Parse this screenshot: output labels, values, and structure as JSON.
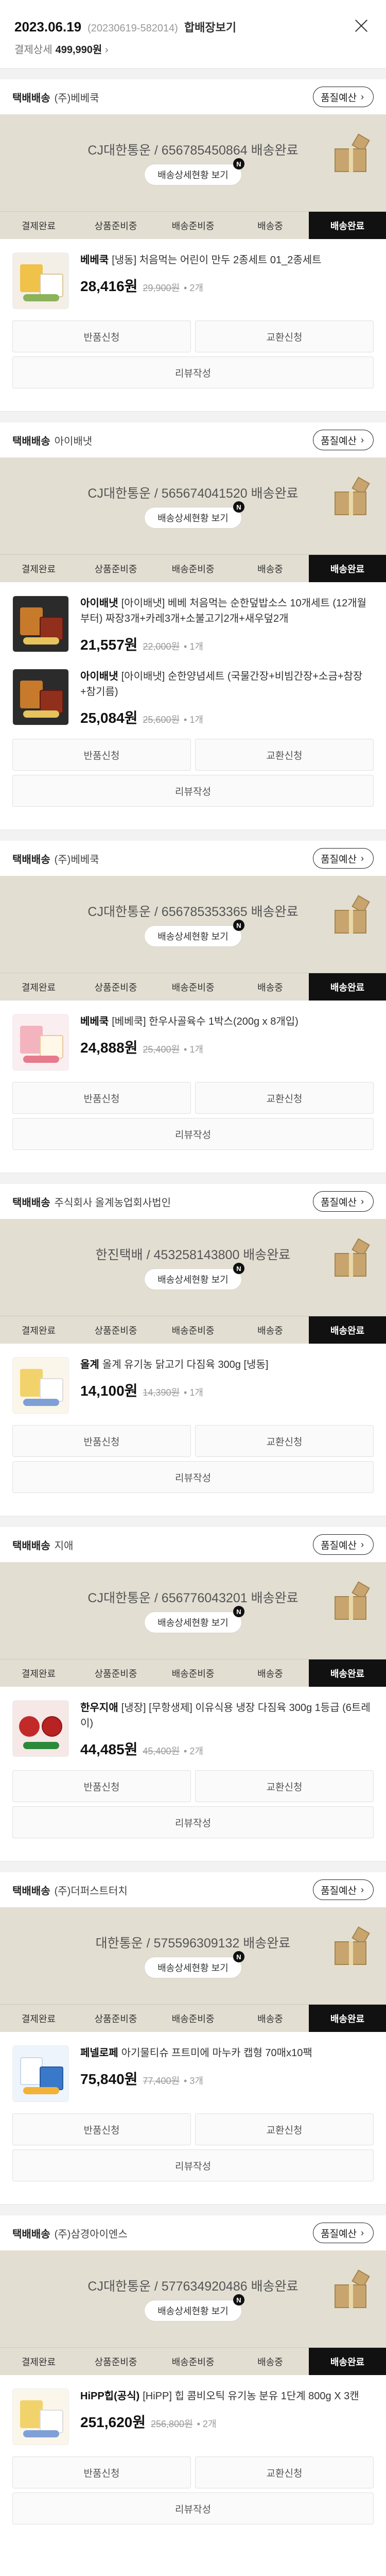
{
  "order": {
    "date": "2023.06.19",
    "number": "(20230619-582014)",
    "merge_label": "합배장보기",
    "pay_label": "결제상세",
    "pay_amount": "499,990원",
    "pay_arrow": "›"
  },
  "common": {
    "quality_label": "품질예산",
    "quality_arrow": "›",
    "tracking_detail_label": "배송상세현황 보기",
    "badge": "N",
    "steps": [
      "결제완료",
      "상품준비중",
      "배송준비중",
      "배송중",
      "배송완료"
    ],
    "return_label": "반품신청",
    "exchange_label": "교환신청",
    "review_label": "리뷰작성"
  },
  "shipments": [
    {
      "carrier": "택배배송",
      "seller": "(주)베베쿡",
      "tracking": "CJ대한통운 / 656785450864 배송완료",
      "products": [
        {
          "brand": "베베쿡",
          "name": "[냉동] 처음먹는 어린이 만두 2종세트 01_2종세트",
          "price": "28,416원",
          "original": "29,900원",
          "qty": "• 2개"
        }
      ]
    },
    {
      "carrier": "택배배송",
      "seller": "아이배냇",
      "tracking": "CJ대한통운 / 565674041520 배송완료",
      "products": [
        {
          "brand": "아이배냇",
          "name": "[아이배냇] 베베 처음먹는 순한덮밥소스 10개세트 (12개월부터) 짜장3개+카레3개+소불고기2개+새우덮2개",
          "price": "21,557원",
          "original": "22,000원",
          "qty": "• 1개"
        },
        {
          "brand": "아이배냇",
          "name": "[아이배냇] 순한양념세트 (국물간장+비빔간장+소금+참장+참기름)",
          "price": "25,084원",
          "original": "25,600원",
          "qty": "• 1개"
        }
      ]
    },
    {
      "carrier": "택배배송",
      "seller": "(주)베베쿡",
      "tracking": "CJ대한통운 / 656785353365 배송완료",
      "products": [
        {
          "brand": "베베쿡",
          "name": "[베베쿡] 한우사골육수 1박스(200g x 8개입)",
          "price": "24,888원",
          "original": "25,400원",
          "qty": "• 1개"
        }
      ]
    },
    {
      "carrier": "택배배송",
      "seller": "주식회사 올계농업회사법인",
      "tracking": "한진택배 / 453258143800 배송완료",
      "products": [
        {
          "brand": "올계",
          "name": "올계 유기농 닭고기 다짐육 300g [냉동]",
          "price": "14,100원",
          "original": "14,390원",
          "qty": "• 1개"
        }
      ]
    },
    {
      "carrier": "택배배송",
      "seller": "지애",
      "tracking": "CJ대한통운 / 656776043201 배송완료",
      "products": [
        {
          "brand": "한우지애",
          "name": "[냉장] [무항생제] 이유식용 냉장 다짐육 300g 1등급 (6트레이)",
          "price": "44,485원",
          "original": "45,400원",
          "qty": "• 2개"
        }
      ]
    },
    {
      "carrier": "택배배송",
      "seller": "(주)더퍼스트터치",
      "tracking": "대한통운 / 575596309132 배송완료",
      "products": [
        {
          "brand": "페넬로페",
          "name": "아기물티슈 프트미에 마누카 캡형 70매x10팩",
          "price": "75,840원",
          "original": "77,400원",
          "qty": "• 3개"
        }
      ]
    },
    {
      "carrier": "택배배송",
      "seller": "(주)삼경아이엔스",
      "tracking": "CJ대한통운 / 577634920486 배송완료",
      "products": [
        {
          "brand": "HiPP힙(공식)",
          "name": "[HiPP] 힙 콤비오틱 유기농 분유 1단계 800g X 3캔",
          "price": "251,620원",
          "original": "256,800원",
          "qty": "• 2개"
        }
      ]
    }
  ]
}
